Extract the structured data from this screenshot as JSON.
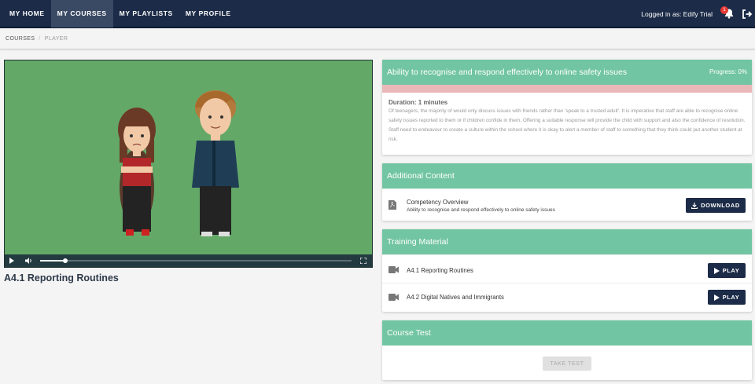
{
  "nav": {
    "items": [
      {
        "label": "MY HOME"
      },
      {
        "label": "MY COURSES"
      },
      {
        "label": "MY PLAYLISTS"
      },
      {
        "label": "MY PROFILE"
      }
    ],
    "active": "MY COURSES",
    "login_text": "Logged in as: Edify Trial",
    "notification_count": "1"
  },
  "breadcrumb": {
    "items": [
      "COURSES",
      "PLAYER"
    ],
    "separator": "/"
  },
  "player": {
    "progress_fraction": 0.08,
    "video_title": "A4.1 Reporting Routines"
  },
  "competency": {
    "title": "Ability to recognise and respond effectively to online safety issues",
    "progress_label": "Progress: 0%",
    "duration": "Duration: 1 minutes",
    "description": "Of teenagers, the majority of would only discuss issues with friends rather than 'speak to a trusted adult'. It is imperative that staff are able to recognise online safety issues reported to them or if children confide in them. Offering a suitable response will provide the child with support and also the confidence of resolution. Staff need to endeavour to create a culture within the school where it is okay to alert a member of staff to something that they think could put another student at risk."
  },
  "additional": {
    "heading": "Additional Content",
    "item_title": "Competency Overview",
    "item_subtitle": "Ability to recognise and respond effectively to online safety issues",
    "download_label": "DOWNLOAD"
  },
  "training": {
    "heading": "Training Material",
    "items": [
      {
        "label": "A4.1 Reporting Routines",
        "button": "PLAY"
      },
      {
        "label": "A4.2 Digital Natives and Immigrants",
        "button": "PLAY"
      }
    ]
  },
  "test": {
    "heading": "Course Test",
    "button": "TAKE TEST"
  },
  "colors": {
    "navbar": "#1c2b47",
    "accent_green": "#72c5a2",
    "progress_track": "#eab8b8",
    "video_bg": "#64a868"
  }
}
